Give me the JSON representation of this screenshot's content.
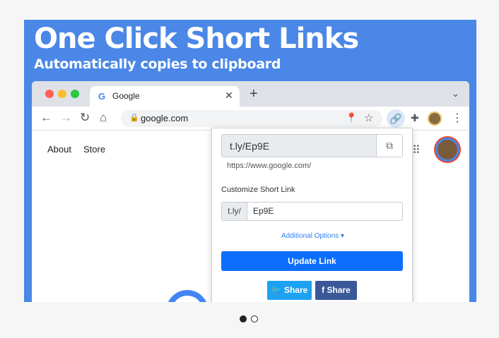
{
  "banner": {
    "headline": "One Click Short Links",
    "subhead": "Automatically copies to clipboard"
  },
  "browser": {
    "tab_icon": "G",
    "tab_title": "Google",
    "tab_close": "✕",
    "new_tab": "+",
    "tab_menu": "⌄",
    "back": "←",
    "forward": "→",
    "reload": "↻",
    "home": "⌂",
    "lock": "🔒",
    "url": "google.com",
    "pin": "📍",
    "star": "☆",
    "ext_link": "🔗",
    "puzzle": "✚",
    "kebab": "⋮"
  },
  "page": {
    "links": [
      "About",
      "Store"
    ],
    "apps": "⠿"
  },
  "popup": {
    "short_link": "t.ly/Ep9E",
    "copy_icon": "⧉",
    "original_url": "https://www.google.com/",
    "customize_label": "Customize Short Link",
    "prefix": "t.ly/",
    "slug": "Ep9E",
    "options_label": "Additional Options ▾",
    "update_label": "Update Link",
    "twitter_label": "🐦 Share",
    "facebook_label": "f Share"
  },
  "carousel": {
    "active_index": 0,
    "count": 2
  }
}
